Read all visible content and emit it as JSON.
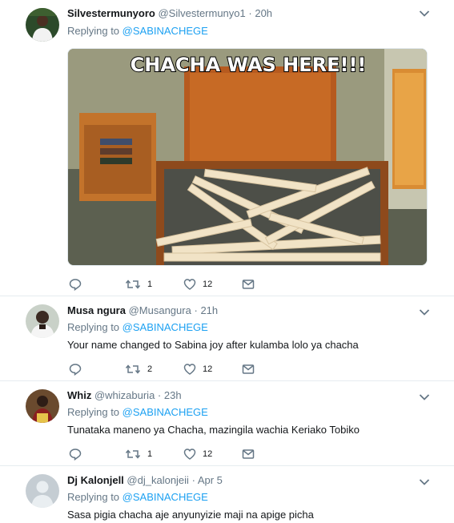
{
  "tweets": [
    {
      "name": "Silvestermunyoro",
      "handle": "@Silvestermunyo1",
      "dot": "·",
      "time": "20h",
      "replying_label": "Replying to",
      "replying_to": "@SABINACHEGE",
      "text": "",
      "media_caption": "CHACHA WAS HERE!!!",
      "retweets": "1",
      "likes": "12"
    },
    {
      "name": "Musa ngura",
      "handle": "@Musangura",
      "dot": "·",
      "time": "21h",
      "replying_label": "Replying to",
      "replying_to": "@SABINACHEGE",
      "text": "Your name changed to Sabina joy after kulamba lolo ya chacha",
      "retweets": "2",
      "likes": "12"
    },
    {
      "name": "Whiz",
      "handle": "@whizaburia",
      "dot": "·",
      "time": "23h",
      "replying_label": "Replying to",
      "replying_to": "@SABINACHEGE",
      "text": "Tunataka maneno ya Chacha,  mazingila wachia Keriako Tobiko",
      "retweets": "1",
      "likes": "12"
    },
    {
      "name": "Dj Kalonjell",
      "handle": "@dj_kalonjeii",
      "dot": "·",
      "time": "Apr 5",
      "replying_label": "Replying to",
      "replying_to": "@SABINACHEGE",
      "text": "Sasa pigia chacha aje anyunyizie maji na apige picha"
    }
  ],
  "colors": {
    "link": "#1da1f2",
    "muted": "#657786",
    "text": "#14171a",
    "divider": "#e6ecf0"
  },
  "icons": [
    "reply-icon",
    "retweet-icon",
    "like-icon",
    "message-icon",
    "chevron-down-icon"
  ]
}
